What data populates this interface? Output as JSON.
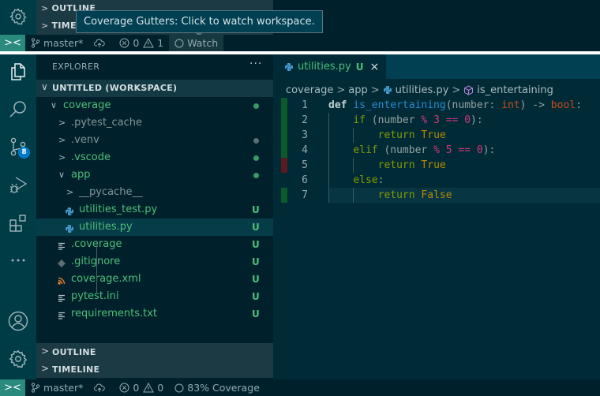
{
  "top_strip": {
    "sections": [
      {
        "label": "OUTLINE"
      },
      {
        "label": "TIMELINE"
      }
    ],
    "tooltip": "Coverage Gutters: Click to watch workspace.",
    "statusbar": {
      "branch": "master*",
      "errors": "0",
      "warnings": "1",
      "coverage_button": "Watch"
    }
  },
  "activity_bar": {
    "items": [
      {
        "name": "explorer",
        "icon": "files-icon"
      },
      {
        "name": "search",
        "icon": "search-icon"
      },
      {
        "name": "source-control",
        "icon": "source-control-icon",
        "badge": "8"
      },
      {
        "name": "run-debug",
        "icon": "debug-icon"
      },
      {
        "name": "extensions",
        "icon": "extensions-icon"
      },
      {
        "name": "more",
        "icon": "more-icon"
      },
      {
        "name": "accounts",
        "icon": "account-icon"
      },
      {
        "name": "manage",
        "icon": "gear-icon"
      }
    ]
  },
  "sidebar": {
    "title": "EXPLORER",
    "more": "···",
    "workspace": "UNTITLED (WORKSPACE)",
    "tree": [
      {
        "name": "coverage",
        "type": "folder",
        "open": true,
        "depth": 0,
        "color": "green",
        "decoration": "dot-green"
      },
      {
        "name": ".pytest_cache",
        "type": "folder",
        "open": false,
        "depth": 1,
        "color": "gray",
        "decoration": ""
      },
      {
        "name": ".venv",
        "type": "folder",
        "open": false,
        "depth": 1,
        "color": "gray",
        "decoration": "dot-gray"
      },
      {
        "name": ".vscode",
        "type": "folder",
        "open": false,
        "depth": 1,
        "color": "green",
        "decoration": "dot-green"
      },
      {
        "name": "app",
        "type": "folder",
        "open": true,
        "depth": 1,
        "color": "green",
        "decoration": "dot-green"
      },
      {
        "name": "__pycache__",
        "type": "folder",
        "open": false,
        "depth": 2,
        "color": "gray",
        "decoration": ""
      },
      {
        "name": "utilities_test.py",
        "type": "python",
        "depth": 2,
        "color": "green",
        "decoration": "U"
      },
      {
        "name": "utilities.py",
        "type": "python",
        "depth": 2,
        "color": "green",
        "decoration": "U",
        "selected": true
      },
      {
        "name": ".coverage",
        "type": "text",
        "depth": 1,
        "color": "green",
        "decoration": "U"
      },
      {
        "name": ".gitignore",
        "type": "git",
        "depth": 1,
        "color": "green",
        "decoration": "U"
      },
      {
        "name": "coverage.xml",
        "type": "rss",
        "depth": 1,
        "color": "green",
        "decoration": "U"
      },
      {
        "name": "pytest.ini",
        "type": "text",
        "depth": 1,
        "color": "green",
        "decoration": "U"
      },
      {
        "name": "requirements.txt",
        "type": "text",
        "depth": 1,
        "color": "green",
        "decoration": "U"
      }
    ],
    "sections": [
      {
        "label": "OUTLINE"
      },
      {
        "label": "TIMELINE"
      }
    ]
  },
  "editor": {
    "tab": {
      "label": "utilities.py",
      "decoration": "U",
      "close": "×"
    },
    "breadcrumb": [
      "coverage",
      "app",
      "utilities.py",
      "is_entertaining"
    ],
    "lines": [
      {
        "n": "1",
        "coverage": "covered",
        "indent": 0,
        "tokens": [
          [
            "kw",
            "def"
          ],
          [
            "id",
            " "
          ],
          [
            "fn",
            "is_entertaining"
          ],
          [
            "id",
            "(number: "
          ],
          [
            "ty",
            "int"
          ],
          [
            "id",
            ") -> "
          ],
          [
            "ty",
            "bool"
          ],
          [
            "id",
            ":"
          ]
        ]
      },
      {
        "n": "2",
        "coverage": "covered",
        "indent": 1,
        "tokens": [
          [
            "ctl",
            "if"
          ],
          [
            "id",
            " (number "
          ],
          [
            "op",
            "%"
          ],
          [
            "id",
            " "
          ],
          [
            "num",
            "3"
          ],
          [
            "id",
            " "
          ],
          [
            "op",
            "=="
          ],
          [
            "id",
            " "
          ],
          [
            "num",
            "0"
          ],
          [
            "id",
            "):"
          ]
        ]
      },
      {
        "n": "3",
        "coverage": "covered",
        "indent": 2,
        "tokens": [
          [
            "ret",
            "return"
          ],
          [
            "id",
            " "
          ],
          [
            "const",
            "True"
          ]
        ]
      },
      {
        "n": "4",
        "coverage": "covered",
        "indent": 1,
        "tokens": [
          [
            "ctl",
            "elif"
          ],
          [
            "id",
            " (number "
          ],
          [
            "op",
            "%"
          ],
          [
            "id",
            " "
          ],
          [
            "num",
            "5"
          ],
          [
            "id",
            " "
          ],
          [
            "op",
            "=="
          ],
          [
            "id",
            " "
          ],
          [
            "num",
            "0"
          ],
          [
            "id",
            "):"
          ]
        ]
      },
      {
        "n": "5",
        "coverage": "uncovered",
        "indent": 2,
        "tokens": [
          [
            "ret",
            "return"
          ],
          [
            "id",
            " "
          ],
          [
            "const",
            "True"
          ]
        ]
      },
      {
        "n": "6",
        "coverage": "none",
        "indent": 1,
        "tokens": [
          [
            "ctl",
            "else"
          ],
          [
            "id",
            ":"
          ]
        ]
      },
      {
        "n": "7",
        "coverage": "covered",
        "indent": 2,
        "current": true,
        "tokens": [
          [
            "ret",
            "return"
          ],
          [
            "id",
            " "
          ],
          [
            "const",
            "False"
          ]
        ]
      }
    ]
  },
  "statusbar": {
    "branch": "master*",
    "errors": "0",
    "warnings": "0",
    "coverage": "83% Coverage"
  },
  "colors": {
    "covered": "#0a5a2a",
    "uncovered": "#5a1a22",
    "accent": "#2a8a7d",
    "badge": "#007acc",
    "git_untracked": "#4ebf79"
  }
}
